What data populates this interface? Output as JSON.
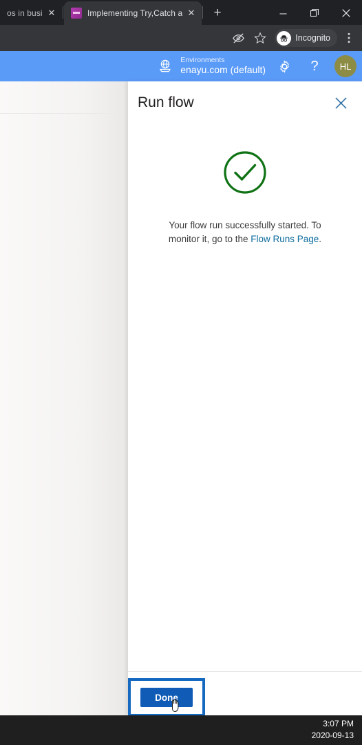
{
  "browser": {
    "tabs": [
      {
        "title": "os in busine",
        "favicon": "none",
        "active": false,
        "close_icon": "close-icon"
      },
      {
        "title": "Implementing Try,Catch and",
        "favicon": "purple-page-icon",
        "active": true,
        "close_icon": "close-icon"
      }
    ],
    "new_tab_label": "+",
    "window_controls": {
      "minimize": "—",
      "maximize": "❐",
      "close": "✕"
    },
    "toolbar": {
      "eye_off_icon": "eye-off-icon",
      "bookmark_icon": "star-icon",
      "incognito_label": "Incognito",
      "menu_icon": "kebab-menu-icon"
    }
  },
  "app_header": {
    "environments_label": "Environments",
    "environments_value": "enayu.com (default)",
    "globe_icon": "environment-globe-icon",
    "settings_icon": "gear-icon",
    "help_icon": "question-mark-icon",
    "avatar_initials": "HL",
    "avatar_color": "#8c8c45",
    "background_color": "#5b9bf8"
  },
  "panel": {
    "title": "Run flow",
    "close_label": "✕",
    "status_icon": "success-check-circle-icon",
    "status_color": "#107c10",
    "message_before_link": "Your flow run successfully started. To monitor it, go to the ",
    "message_link": "Flow Runs Page",
    "message_after_link": ".",
    "link_color": "#0b6a9e",
    "footer": {
      "done_label": "Done",
      "done_color": "#0f5bb5",
      "focus_ring_color": "#1669c1"
    }
  },
  "taskbar": {
    "time": "3:07 PM",
    "date": "2020-09-13"
  }
}
